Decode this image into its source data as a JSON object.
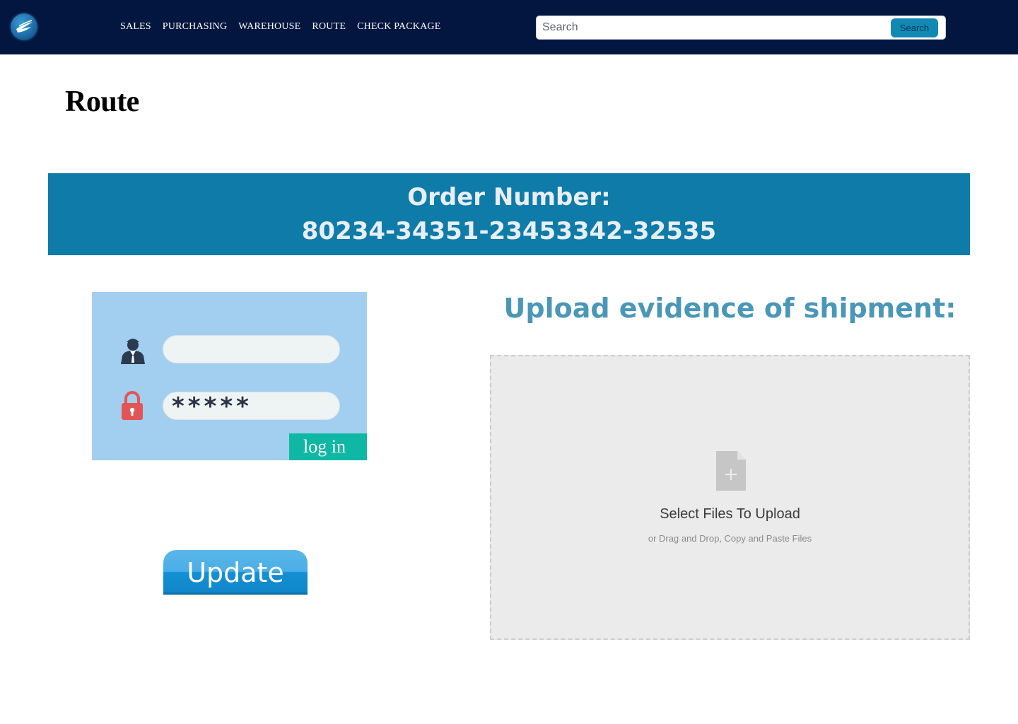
{
  "header": {
    "logo_icon": "wing-logo-icon",
    "nav": [
      {
        "label": "SALES"
      },
      {
        "label": "PURCHASING"
      },
      {
        "label": "WAREHOUSE"
      },
      {
        "label": "ROUTE"
      },
      {
        "label": "CHECK PACKAGE"
      }
    ],
    "search": {
      "placeholder": "Search",
      "button_label": "Search"
    }
  },
  "page": {
    "title": "Route"
  },
  "order": {
    "label": "Order Number:",
    "number": "80234-34351-23453342-32535"
  },
  "login_card": {
    "user_icon": "user-icon",
    "lock_icon": "lock-icon",
    "password_mask": "*****",
    "login_label": "log in"
  },
  "update": {
    "label": "Update"
  },
  "upload": {
    "title": "Upload evidence of shipment:",
    "drop_title": "Select Files To Upload",
    "drop_subtitle": "or Drag and Drop, Copy and Paste Files",
    "file_icon": "file-add-icon"
  },
  "colors": {
    "topbar": "#031640",
    "banner": "#0f7ba8",
    "upload_title": "#4a97b7",
    "login_button": "#0fb8a4",
    "search_button": "#1289b4"
  }
}
